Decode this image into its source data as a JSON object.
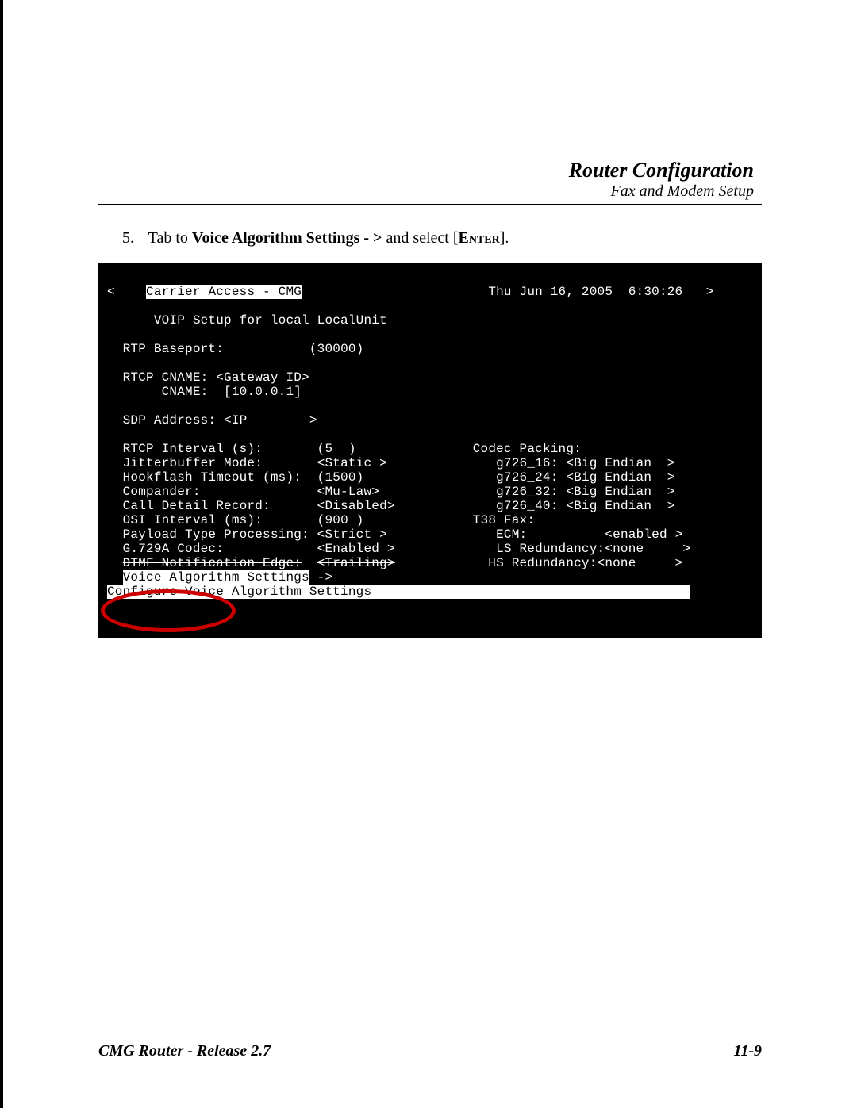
{
  "header": {
    "title": "Router Configuration",
    "subtitle": "Fax and Modem Setup"
  },
  "instruction": {
    "number": "5.",
    "prefix": "Tab to ",
    "bold_part": "Voice Algorithm Settings - >",
    "middle": " and select [",
    "enter": "Enter",
    "suffix": "]."
  },
  "terminal": {
    "top_left_arrow": "<",
    "title": "Carrier Access - CMG",
    "datetime": "Thu Jun 16, 2005  6:30:26",
    "top_right_arrow": ">",
    "subtitle": "VOIP Setup for local LocalUnit",
    "rtp_baseport_label": "RTP Baseport:",
    "rtp_baseport_value": "(30000)",
    "rtcp_cname_label": "RTCP CNAME: <Gateway ID>",
    "cname_label": "CNAME:  [10.0.0.1]",
    "sdp_label": "SDP Address: <IP        >",
    "left_settings": [
      [
        "RTCP Interval (s):",
        "(5  )"
      ],
      [
        "Jitterbuffer Mode:",
        "<Static >"
      ],
      [
        "Hookflash Timeout (ms):",
        "(1500)"
      ],
      [
        "Compander:",
        "<Mu-Law>"
      ],
      [
        "Call Detail Record:",
        "<Disabled>"
      ],
      [
        "OSI Interval (ms):",
        "(900 )"
      ],
      [
        "Payload Type Processing:",
        "<Strict >"
      ],
      [
        "G.729A Codec:",
        "<Enabled >"
      ]
    ],
    "dtmf_line_label": "DTMF Notification Edge:",
    "dtmf_line_value": "<Trailing>",
    "voice_algo_label": "Voice Algorithm Settings",
    "voice_algo_arrow": " ->",
    "right_header": "Codec Packing:",
    "right_settings": [
      [
        "g726_16:",
        "<Big Endian  >"
      ],
      [
        "g726_24:",
        "<Big Endian  >"
      ],
      [
        "g726_32:",
        "<Big Endian  >"
      ],
      [
        "g726_40:",
        "<Big Endian  >"
      ]
    ],
    "t38_header": "T38 Fax:",
    "t38_settings": [
      [
        "ECM:",
        "<enabled >"
      ],
      [
        "LS Redundancy:",
        "<none     >"
      ],
      [
        "HS Redundancy:",
        "<none     >"
      ]
    ],
    "bottom_help": "Configure Voice Algorithm Settings"
  },
  "footer": {
    "left": "CMG Router - Release 2.7",
    "right": "11-9"
  }
}
